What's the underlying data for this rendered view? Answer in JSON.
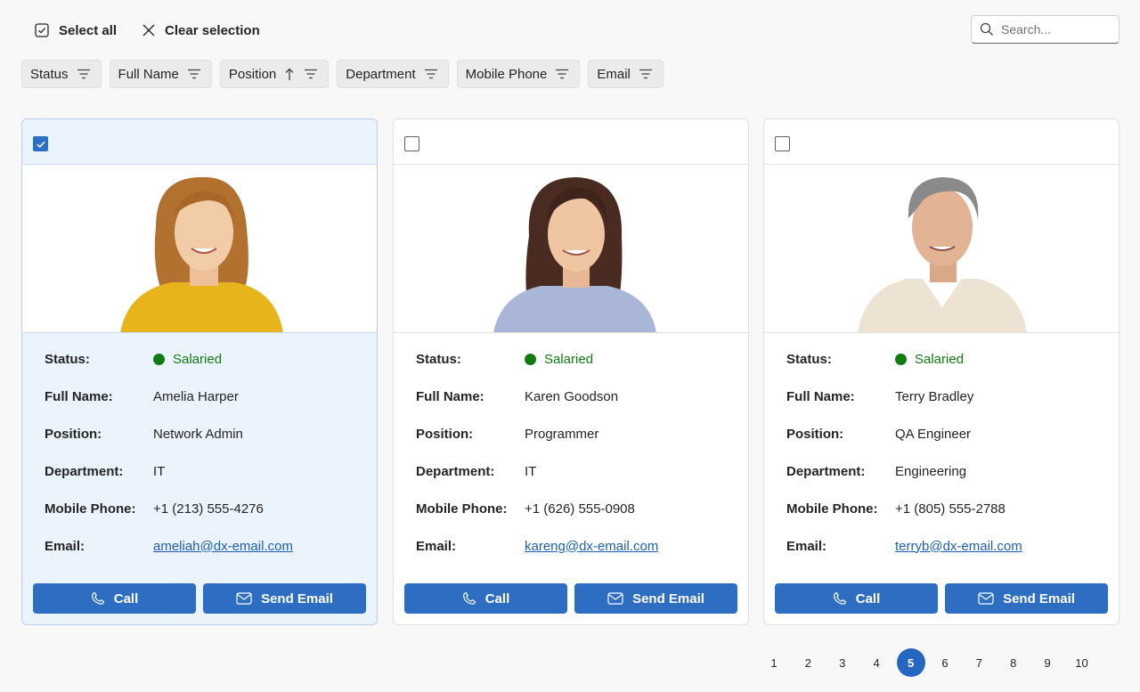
{
  "toolbar": {
    "select_all": "Select all",
    "clear_selection": "Clear selection",
    "search_placeholder": "Search..."
  },
  "chips": [
    {
      "label": "Status",
      "sort": "none"
    },
    {
      "label": "Full Name",
      "sort": "none"
    },
    {
      "label": "Position",
      "sort": "ascending"
    },
    {
      "label": "Department",
      "sort": "none"
    },
    {
      "label": "Mobile Phone",
      "sort": "none"
    },
    {
      "label": "Email",
      "sort": "none"
    }
  ],
  "labels": {
    "status": "Status:",
    "full_name": "Full Name:",
    "position": "Position:",
    "department": "Department:",
    "mobile_phone": "Mobile Phone:",
    "email": "Email:",
    "call_button": "Call",
    "email_button": "Send Email"
  },
  "cards": [
    {
      "selected": true,
      "status": "Salaried",
      "full_name": "Amelia Harper",
      "position": "Network Admin",
      "department": "IT",
      "mobile_phone": "+1 (213) 555-4276",
      "email": "ameliah@dx-email.com"
    },
    {
      "selected": false,
      "status": "Salaried",
      "full_name": "Karen Goodson",
      "position": "Programmer",
      "department": "IT",
      "mobile_phone": "+1 (626) 555-0908",
      "email": "kareng@dx-email.com"
    },
    {
      "selected": false,
      "status": "Salaried",
      "full_name": "Terry Bradley",
      "position": "QA Engineer",
      "department": "Engineering",
      "mobile_phone": "+1 (805) 555-2788",
      "email": "terryb@dx-email.com"
    }
  ],
  "pager": {
    "pages": [
      "1",
      "2",
      "3",
      "4",
      "5",
      "6",
      "7",
      "8",
      "9",
      "10"
    ],
    "current": "5"
  },
  "colors": {
    "accent": "#2e6ec2",
    "status_green": "#107c10",
    "selected_card": "#ebf3fc",
    "link": "#1e5fb5"
  }
}
